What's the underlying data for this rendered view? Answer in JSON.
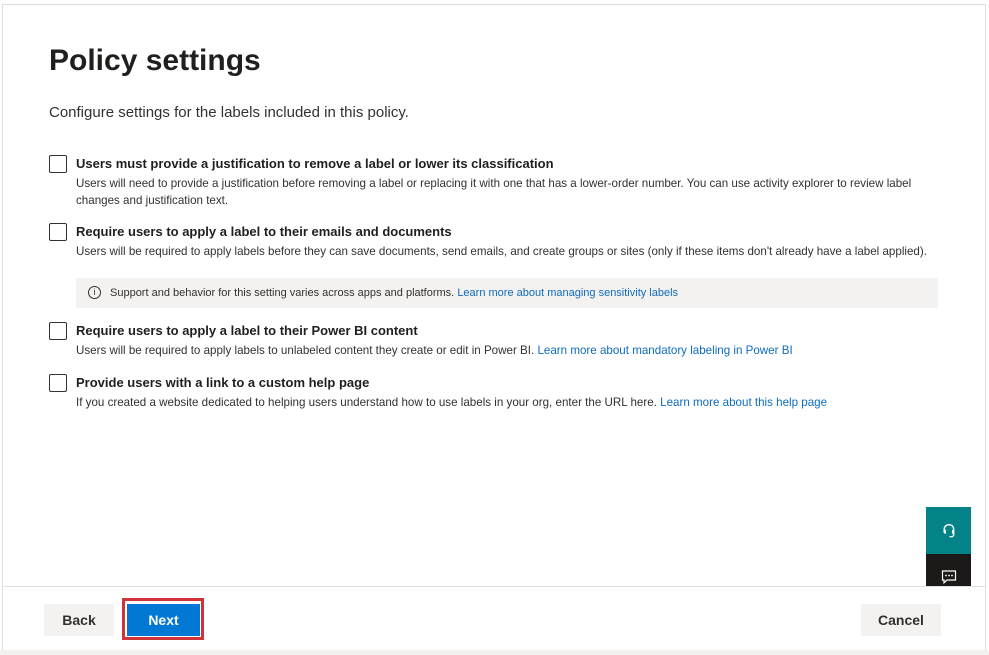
{
  "page": {
    "title": "Policy settings",
    "subtitle": "Configure settings for the labels included in this policy."
  },
  "options": [
    {
      "label": "Users must provide a justification to remove a label or lower its classification",
      "description": "Users will need to provide a justification before removing a label or replacing it with one that has a lower-order number. You can use activity explorer to review label changes and justification text.",
      "checked": false
    },
    {
      "label": "Require users to apply a label to their emails and documents",
      "description": "Users will be required to apply labels before they can save documents, send emails, and create groups or sites (only if these items don't already have a label applied).",
      "checked": false,
      "info": {
        "text": "Support and behavior for this setting varies across apps and platforms.",
        "link": "Learn more about managing sensitivity labels"
      }
    },
    {
      "label": "Require users to apply a label to their Power BI content",
      "description": "Users will be required to apply labels to unlabeled content they create or edit in Power BI.",
      "link": "Learn more about mandatory labeling in Power BI",
      "checked": false
    },
    {
      "label": "Provide users with a link to a custom help page",
      "description": "If you created a website dedicated to helping users understand how to use labels in your org, enter the URL here.",
      "link": "Learn more about this help page",
      "checked": false
    }
  ],
  "side_buttons": {
    "help_icon": "headset-icon",
    "feedback_icon": "feedback-icon"
  },
  "footer": {
    "back_label": "Back",
    "next_label": "Next",
    "cancel_label": "Cancel"
  },
  "colors": {
    "primary": "#0078d4",
    "highlight": "#d13438",
    "help_button": "#038387",
    "feedback_button": "#1b1a19"
  }
}
